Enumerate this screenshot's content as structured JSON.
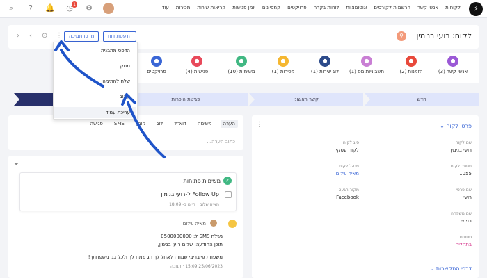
{
  "nav": {
    "links": [
      "לקוחות",
      "אנשי קשר",
      "הרשמות לקורסים",
      "אוטומציות",
      "לוחות בקרה",
      "פרויקטים",
      "קמפיינים",
      "יומן פגישות",
      "קריאות שירות",
      "מכירות",
      "עוד"
    ],
    "notification_badge": "1"
  },
  "header": {
    "title": "לקוח: רועי בנימין",
    "print_button": "הדפסת דוח",
    "support_button": "מרכז תמיכה"
  },
  "menu": {
    "items": [
      "הדפס מתבנית",
      "מחק",
      "שלח לחתימה",
      "עקוב",
      "עריכת עמוד"
    ]
  },
  "stats": [
    {
      "label": "אנשי קשר (3)",
      "color": "#9b59d6"
    },
    {
      "label": "הזמנות (2)",
      "color": "#e8493b"
    },
    {
      "label": "חשבוניות מס (1)",
      "color": "#c97fd4"
    },
    {
      "label": "לוג שירות (1)",
      "color": "#2c4a8a"
    },
    {
      "label": "מכירות (1)",
      "color": "#f5b731"
    },
    {
      "label": "משימות (10)",
      "color": "#41b883"
    },
    {
      "label": "פגישות (4)",
      "color": "#e8495b"
    },
    {
      "label": "פרויקטים",
      "color": "#3a66d6"
    }
  ],
  "pipeline": [
    "חדש",
    "קשר ראשוני",
    "פגישת היכרות"
  ],
  "activity": {
    "tabs": [
      "הערה",
      "משימה",
      "דוא\"ל",
      "לוג",
      "קובץ",
      "SMS",
      "פגישה"
    ],
    "note_placeholder": "כתוב הערה..."
  },
  "tasks": {
    "title": "משימות פתוחות",
    "item": "Follow Up ל-רועי בנימין",
    "meta_user": "מאיה שלום",
    "meta_time": "היום ב- 18:09"
  },
  "sms": {
    "author": "מאיה שלום",
    "line1": "נשלח SMS ל: 0500000000",
    "line2": "תוכן ההודעה: שלום  רועי בנימין,",
    "line3": "משפחת פייבריבי שמחה לאחל לך חג שמח לך ולכל בני משפחתך!",
    "date": "25/06/2023 15:09",
    "reply": "תגובה"
  },
  "details": {
    "title": "פרטי לקוח",
    "fields": [
      {
        "label": "שם לקוח",
        "value": "רועי בנימין"
      },
      {
        "label": "סוג לקוח",
        "value": "לקוח עסקי"
      },
      {
        "label": "מספר לקוח",
        "value": "1055"
      },
      {
        "label": "מנהל לקוח",
        "value": "מאיה שלום"
      },
      {
        "label": "שם פרטי",
        "value": "רועי"
      },
      {
        "label": "מקור הגעה",
        "value": "Facebook"
      },
      {
        "label": "שם משפחה",
        "value": "בנימין"
      },
      {
        "label": "סטטוס",
        "value": "בתהליך"
      }
    ],
    "contact_methods": "דרכי התקשרות"
  },
  "colors": {
    "accent": "#3a66d6",
    "pipeline_dark": "#28306b",
    "arrow": "#1f54c9"
  }
}
